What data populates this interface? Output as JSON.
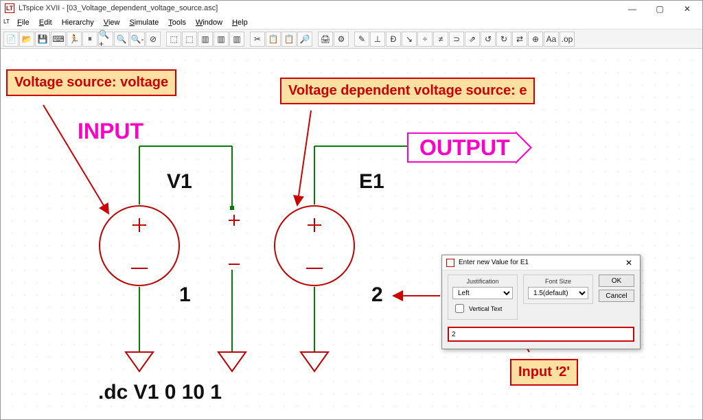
{
  "window": {
    "title": "LTspice XVII - [03_Voltage_dependent_voltage_source.asc]",
    "min": "—",
    "max": "▢",
    "close": "✕"
  },
  "menu": {
    "file": "File",
    "edit": "Edit",
    "hierarchy": "Hierarchy",
    "view": "View",
    "simulate": "Simulate",
    "tools": "Tools",
    "window": "Window",
    "help": "Help"
  },
  "toolbar_icons": [
    "📄",
    "📂",
    "💾",
    "⌨",
    "🏃",
    "⏸",
    "🔍+",
    "🔍",
    "🔍-",
    "⊘",
    "|",
    "⬚",
    "⬚",
    "▥",
    "▥",
    "▥",
    "|",
    "✂",
    "📋",
    "📋",
    "🔎",
    "|",
    "🖨",
    "⚙",
    "|",
    "✎",
    "⊥",
    "Đ",
    "↘",
    "÷",
    "≠",
    "⊃",
    "⇗",
    "↺",
    "↻",
    "⇄",
    "⊕",
    "Aa",
    ".op"
  ],
  "callouts": {
    "vs": "Voltage source: voltage",
    "vdvs": "Voltage dependent voltage source: e",
    "input2": "Input '2'"
  },
  "labels": {
    "input": "INPUT",
    "output": "OUTPUT",
    "v1": "V1",
    "e1": "E1",
    "val1": "1",
    "val2": "2",
    "directive": ".dc V1 0 10 1"
  },
  "dialog": {
    "title": "Enter new Value for E1",
    "justification_label": "Justification",
    "justification_value": "Left",
    "fontsize_label": "Font Size",
    "fontsize_value": "1.5(default)",
    "vertical": "Vertical Text",
    "ok": "OK",
    "cancel": "Cancel",
    "value": "2"
  }
}
